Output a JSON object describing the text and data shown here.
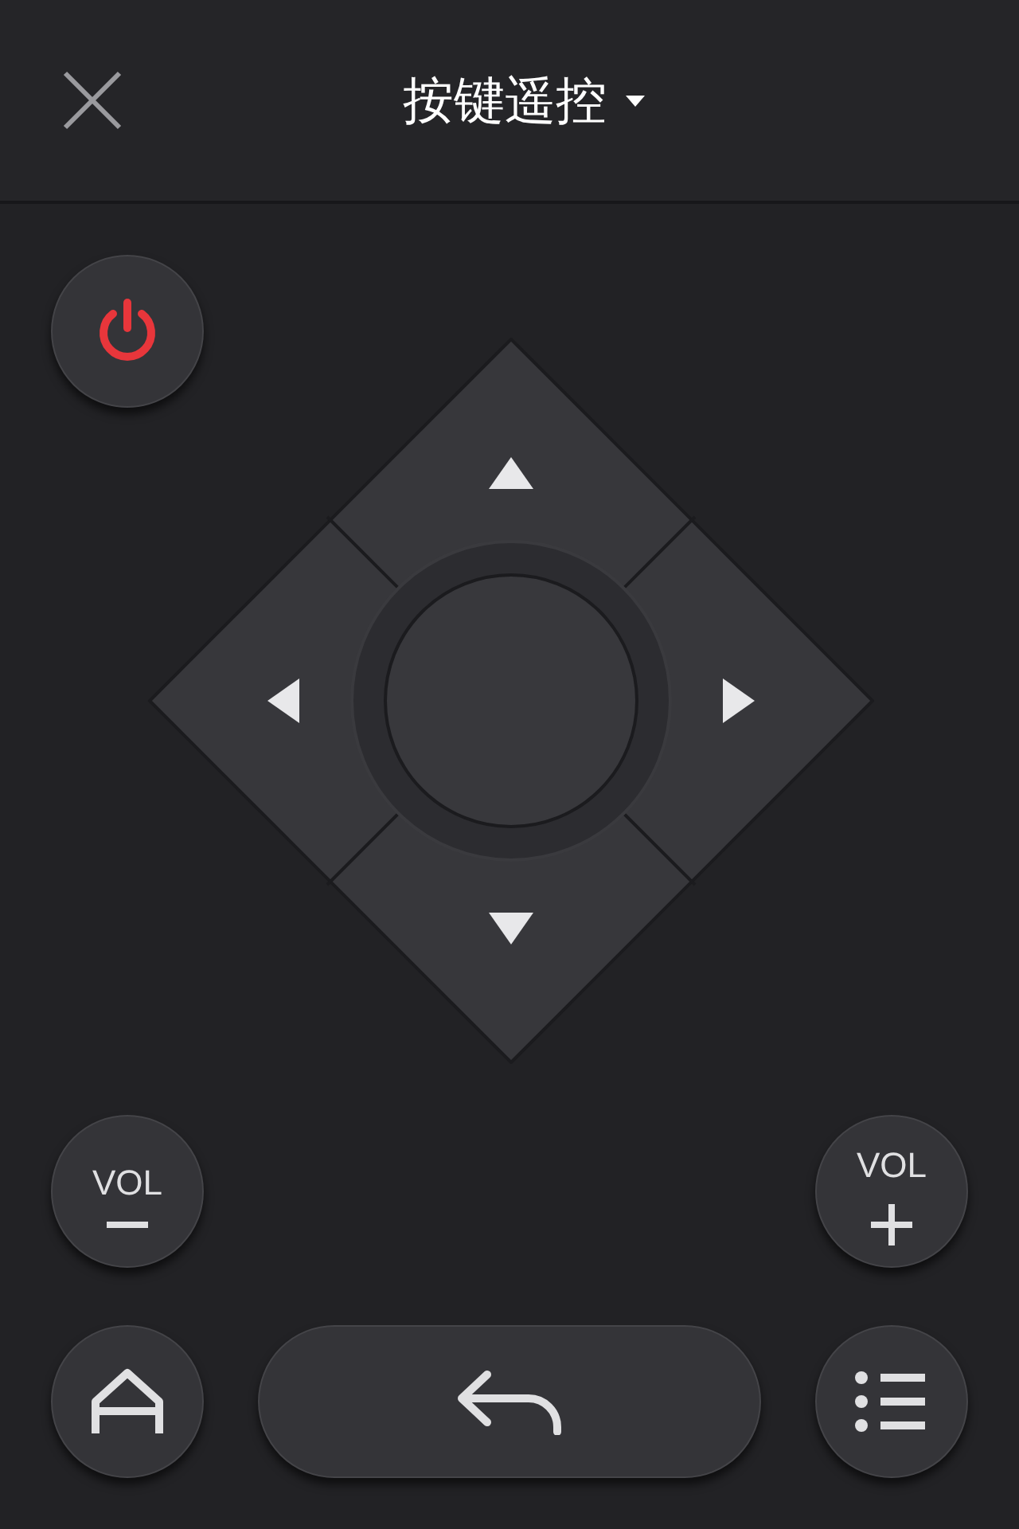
{
  "header": {
    "title": "按键遥控"
  },
  "volume_buttons": [
    {
      "label": "VOL",
      "kind": "minus"
    },
    {
      "label": "VOL",
      "kind": "plus"
    }
  ]
}
